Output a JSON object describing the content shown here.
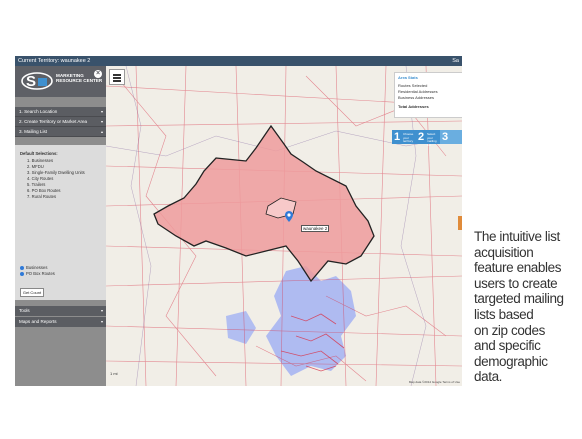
{
  "window": {
    "title": "Current Territory: waunakee 2",
    "title_right": "Sa"
  },
  "logo": {
    "line1": "MARKETING",
    "line2": "RESOURCE CENTER"
  },
  "menu": [
    {
      "label": "1. Search Location"
    },
    {
      "label": "2. Create Territory or Market Area"
    },
    {
      "label": "3. Mailing List"
    }
  ],
  "mailing_list": {
    "heading": "Default Selections:",
    "items": [
      "1. Businesses",
      "2. MFDU",
      "3. Single-Family Dwelling Units",
      "4. City Routes",
      "5. Trailers",
      "6. PO Box Routes",
      "7. Rural Routes"
    ],
    "radios": [
      "Businesses",
      "PO Box Routes"
    ],
    "get_count": "Get Count"
  },
  "bottom_menu": [
    {
      "label": "Tools"
    },
    {
      "label": "Maps and Reports"
    }
  ],
  "area_stats": {
    "title": "Area Stats",
    "rows": [
      "Routes Selected",
      "Residential Addresses",
      "Business Addresses",
      "Total Addresses"
    ]
  },
  "steps": [
    {
      "num": "1",
      "text": "Choose your territory"
    },
    {
      "num": "2",
      "text": "Select your mailing list"
    },
    {
      "num": "3",
      "text": ""
    }
  ],
  "map": {
    "place_label": "waunakee 2",
    "zoom_label": "1 mi",
    "copyright": "Map data ©2014 Google   Terms of Use",
    "territory_color": "#ef9b9c",
    "water_color": "#a7b5f2",
    "route_color": "#d8354b"
  },
  "caption": [
    "The intuitive list",
    "acquisition",
    "feature enables",
    "users to create",
    "targeted mailing",
    "lists based",
    "on zip codes",
    "and specific",
    "demographic",
    "data."
  ]
}
